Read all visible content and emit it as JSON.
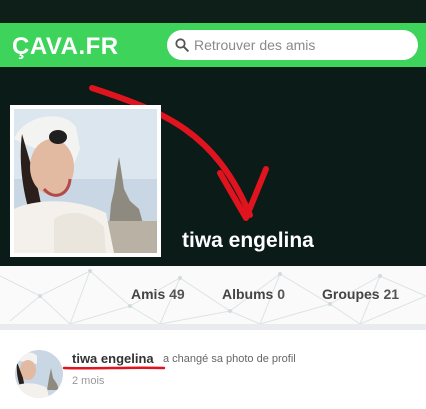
{
  "header": {
    "logo": "ÇAVA.FR",
    "search_placeholder": "Retrouver des amis"
  },
  "profile": {
    "name": "tiwa engelina"
  },
  "stats": [
    {
      "label": "Amis",
      "count": "49"
    },
    {
      "label": "Albums",
      "count": "0"
    },
    {
      "label": "Groupes",
      "count": "21"
    }
  ],
  "post": {
    "author": "tiwa engelina",
    "action": "a changé sa photo de profil",
    "time": "2 mois"
  },
  "colors": {
    "brand_green": "#3ed35a",
    "cover_dark": "#0b1b17",
    "annotation_red": "#e0141e"
  }
}
